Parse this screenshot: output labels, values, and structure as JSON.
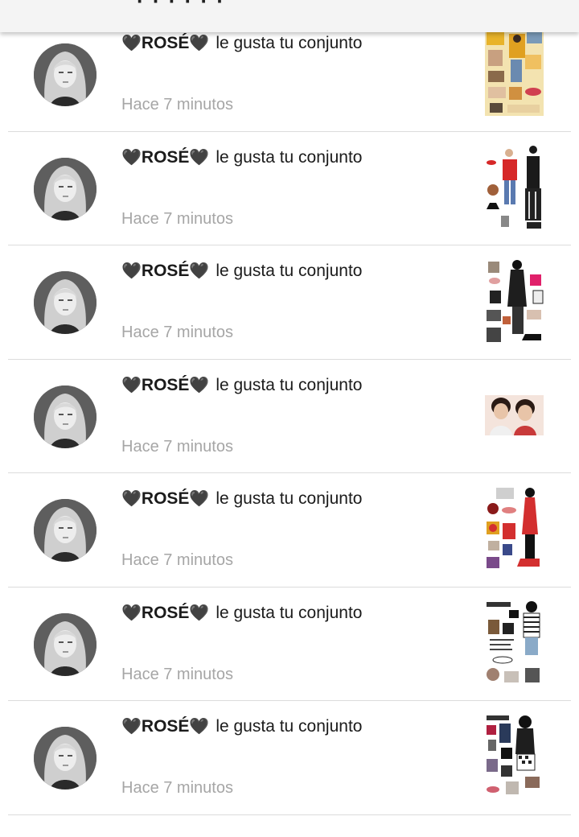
{
  "header": {
    "title": "· · · · · ·"
  },
  "notifications": [
    {
      "heart_left": "🖤",
      "username": "ROSÉ",
      "heart_right": "🖤",
      "action": "le gusta tu conjunto",
      "time": "Hace 7 minutos",
      "thumbnail_icon": "outfit-collage-yellow",
      "colors": {
        "accent": "#e8b32a"
      }
    },
    {
      "heart_left": "🖤",
      "username": "ROSÉ",
      "heart_right": "🖤",
      "action": "le gusta tu conjunto",
      "time": "Hace 7 minutos",
      "thumbnail_icon": "outfit-collage-couple",
      "colors": {
        "accent": "#d62828"
      }
    },
    {
      "heart_left": "🖤",
      "username": "ROSÉ",
      "heart_right": "🖤",
      "action": "le gusta tu conjunto",
      "time": "Hace 7 minutos",
      "thumbnail_icon": "outfit-collage-black",
      "colors": {
        "accent": "#e0206a"
      }
    },
    {
      "heart_left": "🖤",
      "username": "ROSÉ",
      "heart_right": "🖤",
      "action": "le gusta tu conjunto",
      "time": "Hace 7 minutos",
      "thumbnail_icon": "photo-two-people",
      "colors": {
        "accent": "#c83a3a"
      }
    },
    {
      "heart_left": "🖤",
      "username": "ROSÉ",
      "heart_right": "🖤",
      "action": "le gusta tu conjunto",
      "time": "Hace 7 minutos",
      "thumbnail_icon": "outfit-collage-red",
      "colors": {
        "accent": "#d32f2f"
      }
    },
    {
      "heart_left": "🖤",
      "username": "ROSÉ",
      "heart_right": "🖤",
      "action": "le gusta tu conjunto",
      "time": "Hace 7 minutos",
      "thumbnail_icon": "outfit-collage-stripes",
      "colors": {
        "accent": "#7a5a3a"
      }
    },
    {
      "heart_left": "🖤",
      "username": "ROSÉ",
      "heart_right": "🖤",
      "action": "le gusta tu conjunto",
      "time": "Hace 7 minutos",
      "thumbnail_icon": "outfit-collage-dark",
      "colors": {
        "accent": "#b02040"
      }
    }
  ],
  "colors": {
    "text_primary": "#1b1b1b",
    "text_secondary": "#a6a6a6",
    "divider": "#dcdcdc",
    "header_bg": "#f4f4f4"
  }
}
